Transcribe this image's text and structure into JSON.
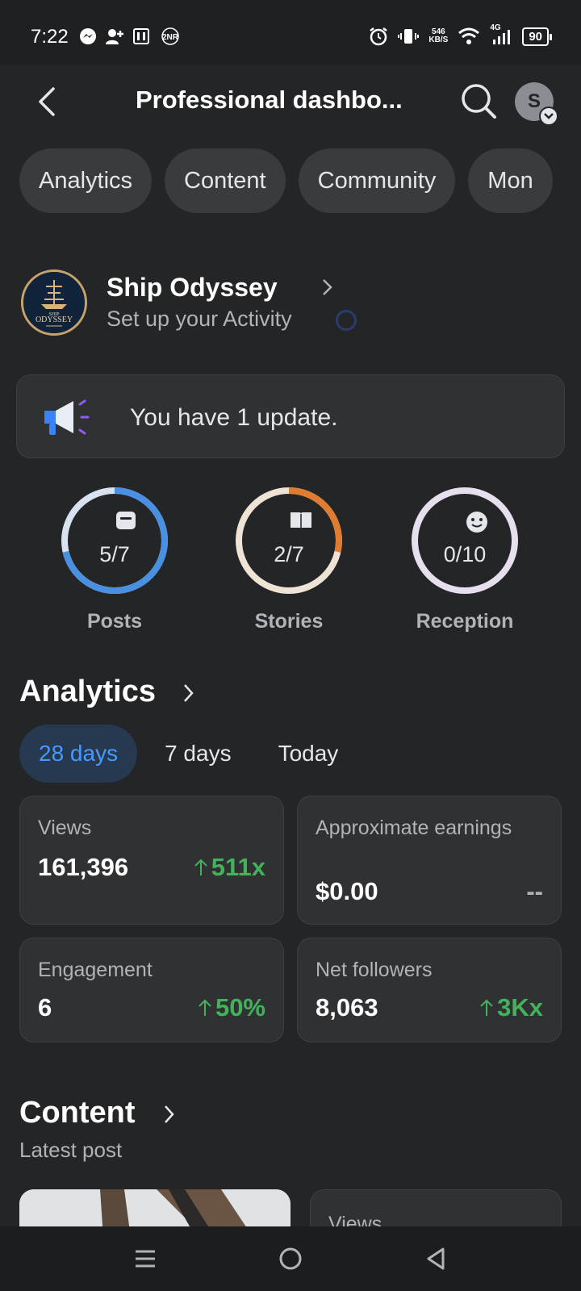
{
  "status_bar": {
    "time": "7:22",
    "net_speed_value": "546",
    "net_speed_unit": "KB/S",
    "network": "4G",
    "battery": "90",
    "icons": [
      "messenger-icon",
      "person-add-icon",
      "sim-icon",
      "data-icon",
      "alarm-icon",
      "vibrate-icon",
      "wifi-icon",
      "signal-icon"
    ]
  },
  "header": {
    "title": "Professional dashbo...",
    "avatar_initial": "S"
  },
  "chips": [
    "Analytics",
    "Content",
    "Community",
    "Mon"
  ],
  "profile": {
    "name": "Ship Odyssey",
    "subtitle": "Set up your Activity",
    "logo_text_top": "SHIP",
    "logo_text": "ODYSSEY"
  },
  "update": {
    "text": "You have 1 update."
  },
  "rings": [
    {
      "label": "Posts",
      "value": "5/7",
      "progress": 0.714,
      "color": "#4a90e2",
      "track": "#d9e3ef"
    },
    {
      "label": "Stories",
      "value": "2/7",
      "progress": 0.286,
      "color": "#e07c2f",
      "track": "#efe3d6"
    },
    {
      "label": "Reception",
      "value": "0/10",
      "progress": 0.0,
      "color": "#c9b8d9",
      "track": "#e8dfee"
    }
  ],
  "analytics": {
    "title": "Analytics",
    "tabs": [
      "28 days",
      "7 days",
      "Today"
    ],
    "active_tab": "28 days",
    "cards": {
      "views": {
        "label": "Views",
        "value": "161,396",
        "change": "511x"
      },
      "earnings": {
        "label": "Approximate earnings",
        "value": "$0.00",
        "change": "--"
      },
      "engagement": {
        "label": "Engagement",
        "value": "6",
        "change": "50%"
      },
      "followers": {
        "label": "Net followers",
        "value": "8,063",
        "change": "3Kx"
      }
    }
  },
  "content": {
    "title": "Content",
    "subtitle": "Latest post",
    "card_label": "Views"
  },
  "colors": {
    "background": "#242526",
    "card": "#303132",
    "accent": "#4599ff",
    "positive": "#43b35b"
  }
}
